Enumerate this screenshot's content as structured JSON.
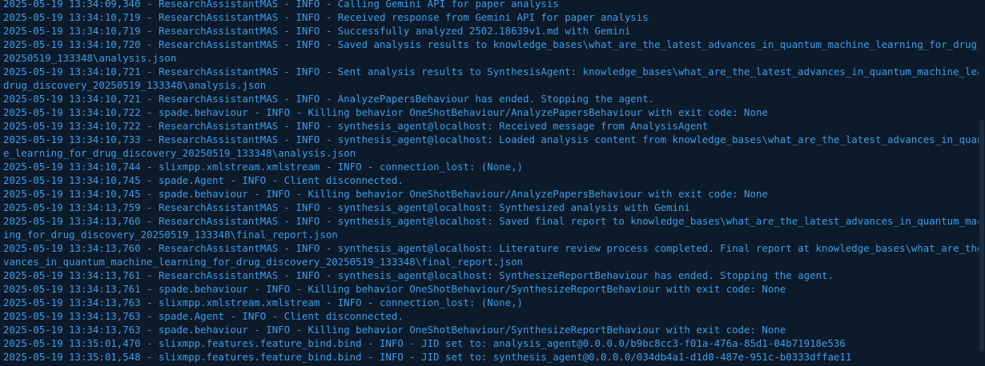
{
  "terminal": {
    "lines": [
      "2025-05-19 13:34:09,340 - ResearchAssistantMAS - INFO - Calling Gemini API for paper analysis",
      "2025-05-19 13:34:10,719 - ResearchAssistantMAS - INFO - Received response from Gemini API for paper analysis",
      "2025-05-19 13:34:10,719 - ResearchAssistantMAS - INFO - Successfully analyzed 2502.18639v1.md with Gemini",
      "2025-05-19 13:34:10,720 - ResearchAssistantMAS - INFO - Saved analysis results to knowledge_bases\\what_are_the_latest_advances_in_quantum_machine_learning_for_drug_discovery_",
      "20250519_133348\\analysis.json",
      "2025-05-19 13:34:10,721 - ResearchAssistantMAS - INFO - Sent analysis results to SynthesisAgent: knowledge_bases\\what_are_the_latest_advances_in_quantum_machine_learning_for_",
      "drug_discovery_20250519_133348\\analysis.json",
      "2025-05-19 13:34:10,721 - ResearchAssistantMAS - INFO - AnalyzePapersBehaviour has ended. Stopping the agent.",
      "2025-05-19 13:34:10,722 - spade.behaviour - INFO - Killing behavior OneShotBehaviour/AnalyzePapersBehaviour with exit code: None",
      "2025-05-19 13:34:10,722 - ResearchAssistantMAS - INFO - synthesis_agent@localhost: Received message from AnalysisAgent",
      "2025-05-19 13:34:10,733 - ResearchAssistantMAS - INFO - synthesis_agent@localhost: Loaded analysis content from knowledge_bases\\what_are_the_latest_advances_in_quantum_machin",
      "e_learning_for_drug_discovery_20250519_133348\\analysis.json",
      "2025-05-19 13:34:10,744 - slixmpp.xmlstream.xmlstream - INFO - connection_lost: (None,)",
      "2025-05-19 13:34:10,745 - spade.Agent - INFO - Client disconnected.",
      "2025-05-19 13:34:10,745 - spade.behaviour - INFO - Killing behavior OneShotBehaviour/AnalyzePapersBehaviour with exit code: None",
      "2025-05-19 13:34:13,759 - ResearchAssistantMAS - INFO - synthesis_agent@localhost: Synthesized analysis with Gemini",
      "2025-05-19 13:34:13,760 - ResearchAssistantMAS - INFO - synthesis_agent@localhost: Saved final report to knowledge_bases\\what_are_the_latest_advances_in_quantum_machine_learn",
      "ing_for_drug_discovery_20250519_133348\\final_report.json",
      "2025-05-19 13:34:13,760 - ResearchAssistantMAS - INFO - synthesis_agent@localhost: Literature review process completed. Final report at knowledge_bases\\what_are_the_latest_ad",
      "vances_in_quantum_machine_learning_for_drug_discovery_20250519_133348\\final_report.json",
      "2025-05-19 13:34:13,761 - ResearchAssistantMAS - INFO - synthesis_agent@localhost: SynthesizeReportBehaviour has ended. Stopping the agent.",
      "2025-05-19 13:34:13,761 - spade.behaviour - INFO - Killing behavior OneShotBehaviour/SynthesizeReportBehaviour with exit code: None",
      "2025-05-19 13:34:13,763 - slixmpp.xmlstream.xmlstream - INFO - connection_lost: (None,)",
      "2025-05-19 13:34:13,763 - spade.Agent - INFO - Client disconnected.",
      "2025-05-19 13:34:13,763 - spade.behaviour - INFO - Killing behavior OneShotBehaviour/SynthesizeReportBehaviour with exit code: None",
      "2025-05-19 13:35:01,470 - slixmpp.features.feature_bind.bind - INFO - JID set to: analysis_agent@0.0.0.0/b9bc8cc3-f01a-476a-85d1-04b71918e536",
      "2025-05-19 13:35:01,548 - slixmpp.features.feature_bind.bind - INFO - JID set to: synthesis_agent@0.0.0.0/034db4a1-d1d0-487e-951c-b0333dffae11"
    ]
  },
  "colors": {
    "background": "#0c1a2a",
    "text": "#3d9ee8"
  }
}
